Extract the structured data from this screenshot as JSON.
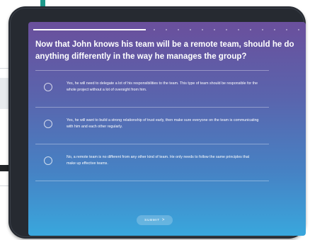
{
  "quiz": {
    "progress": 0.42,
    "question": "Now that John knows his team will be a remote team, should he do anything differently in the way he manages the group?",
    "options": [
      {
        "text": "Yes, he will need to delegate a lot of his responsibilities to the team. This type of team should be responsible for the whole project without a lot of oversight from him."
      },
      {
        "text": "Yes, he will want to build a strong relationship of trust early, then make sure everyone on the team is communicating with him and each other regularly."
      },
      {
        "text": "No, a remote team is no different from any other kind of team. He only needs to follow the same principles that make up effective teams."
      }
    ],
    "submit_label": "SUBMIT",
    "submit_icon": ">"
  },
  "colors": {
    "gradient_top": "#6a4f9c",
    "gradient_bottom": "#39a7dd",
    "device_frame": "#262a31"
  }
}
